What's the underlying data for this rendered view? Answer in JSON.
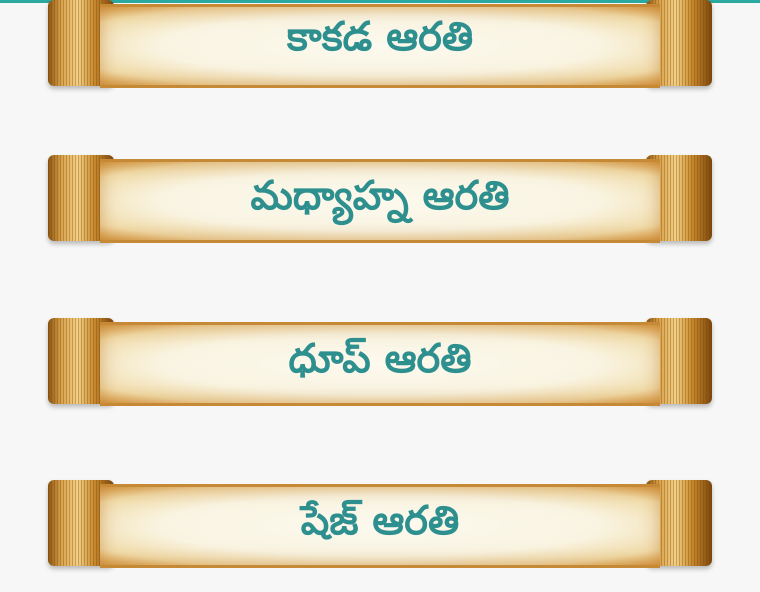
{
  "aarti_list": {
    "items": [
      {
        "label": "కాకడ ఆరతి"
      },
      {
        "label": "మధ్యాహ్న ఆరతి"
      },
      {
        "label": "ధూప్ ఆరతి"
      },
      {
        "label": "షేజ్ ఆరతి"
      }
    ]
  },
  "colors": {
    "label_text": "#2e8f8f",
    "accent_bar": "#2aa9a0",
    "background": "#f7f7f7"
  }
}
